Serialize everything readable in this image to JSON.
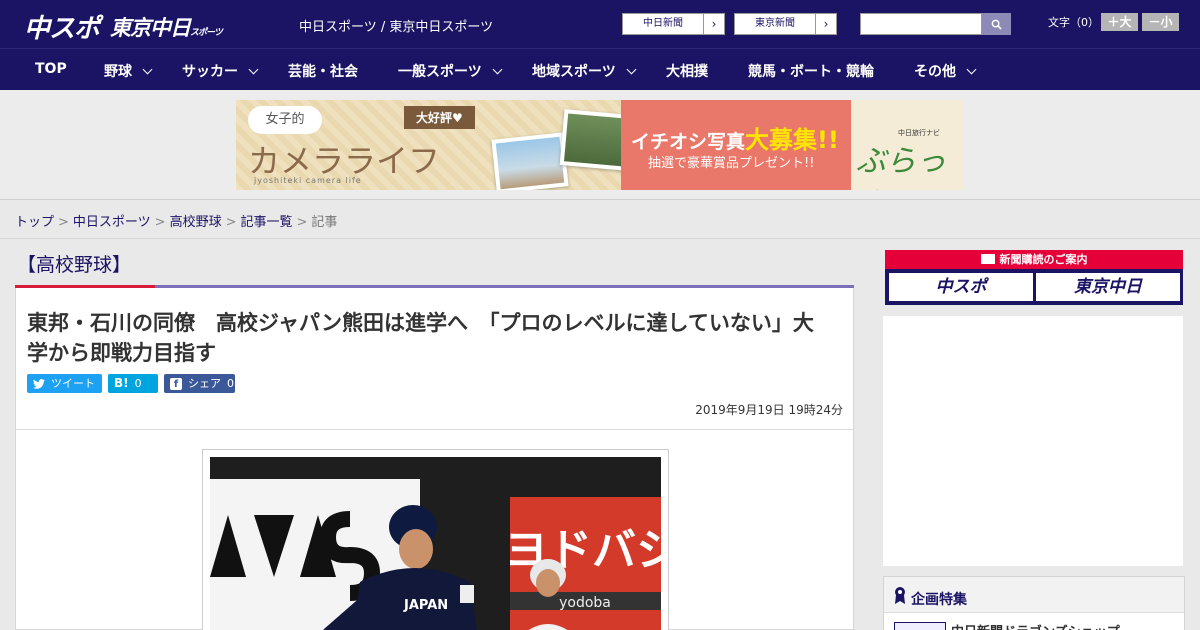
{
  "header": {
    "logo_chuspo": "中スポ",
    "logo_tokyo": "東京中日",
    "logo_tokyo_small": "スポーツ",
    "site_links": "中日スポーツ / 東京中日スポーツ",
    "paper_chunichi": "中日新聞",
    "paper_tokyo": "東京新聞",
    "search_placeholder": "",
    "font_size_label": "文字（0）",
    "font_bigger": "＋大",
    "font_smaller": "－小"
  },
  "nav": [
    "TOP",
    "野球",
    "サッカー",
    "芸能・社会",
    "一般スポーツ",
    "地域スポーツ",
    "大相撲",
    "競馬・ボート・競輪",
    "その他"
  ],
  "banner": {
    "bubble": "女子的",
    "big": "カメラライフ",
    "sub": "jyoshiteki camera life",
    "tag": "大好評♥",
    "main_prefix": "イチオシ写真",
    "main_emph": "大募集",
    "main_suffix": "!!",
    "prize": "抽選で豪華賞品プレゼント!!",
    "brand_small": "中日旅行ナビ",
    "brand_big": "ぶらっ人"
  },
  "breadcrumb": [
    "トップ",
    "中日スポーツ",
    "高校野球",
    "記事一覧",
    "記事"
  ],
  "article": {
    "category": "【高校野球】",
    "headline": "東邦・石川の同僚　高校ジャパン熊田は進学へ　「プロのレベルに達していない」大学から即戦力目指す",
    "tweet_label": "ツイート",
    "hatena_label": "B!",
    "hatena_count": "0",
    "share_label": "シェア",
    "share_count": "0",
    "date": "2019年9月19日 19時24分"
  },
  "sidebar": {
    "notice_head": "新聞購読のご案内",
    "logo_chuspo": "中スポ",
    "logo_tokyo": "東京中日",
    "feature_title": "企画特集",
    "feature_item": "中日新聞ドラゴンズショップ"
  },
  "colors": {
    "brand_navy": "#1b1464",
    "accent_red": "#e60039",
    "twitter": "#1da1f2",
    "hatena": "#00a4de",
    "facebook": "#3b5998"
  }
}
